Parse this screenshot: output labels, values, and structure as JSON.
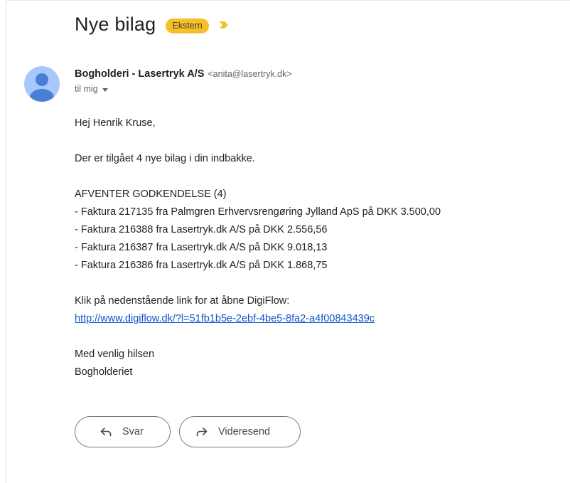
{
  "subject": {
    "title": "Nye bilag",
    "badge": "Ekstern",
    "badge_color": "#f6c026",
    "important_icon": "importance-marker-icon"
  },
  "sender": {
    "name": "Bogholderi - Lasertryk A/S",
    "email": "<anita@lasertryk.dk>",
    "to_label": "til mig",
    "avatar_icon": "default-person-avatar-icon"
  },
  "message": {
    "greeting": "Hej Henrik Kruse,",
    "intro": "Der er tilgået 4 nye bilag i din indbakke.",
    "section_heading": "AFVENTER GODKENDELSE (4)",
    "items": [
      "- Faktura 217135 fra Palmgren Erhvervsrengøring Jylland ApS på DKK 3.500,00",
      "- Faktura 216388 fra Lasertryk.dk A/S på DKK 2.556,56",
      "- Faktura 216387 fra Lasertryk.dk A/S på DKK 9.018,13",
      "- Faktura 216386 fra Lasertryk.dk A/S på DKK 1.868,75"
    ],
    "link_intro": "Klik på nedenstående link for at åbne DigiFlow:",
    "link": "http://www.digiflow.dk/?l=51fb1b5e-2ebf-4be5-8fa2-a4f00843439c",
    "closing": "Med venlig hilsen",
    "signature": "Bogholderiet"
  },
  "actions": {
    "reply_label": "Svar",
    "forward_label": "Videresend"
  }
}
